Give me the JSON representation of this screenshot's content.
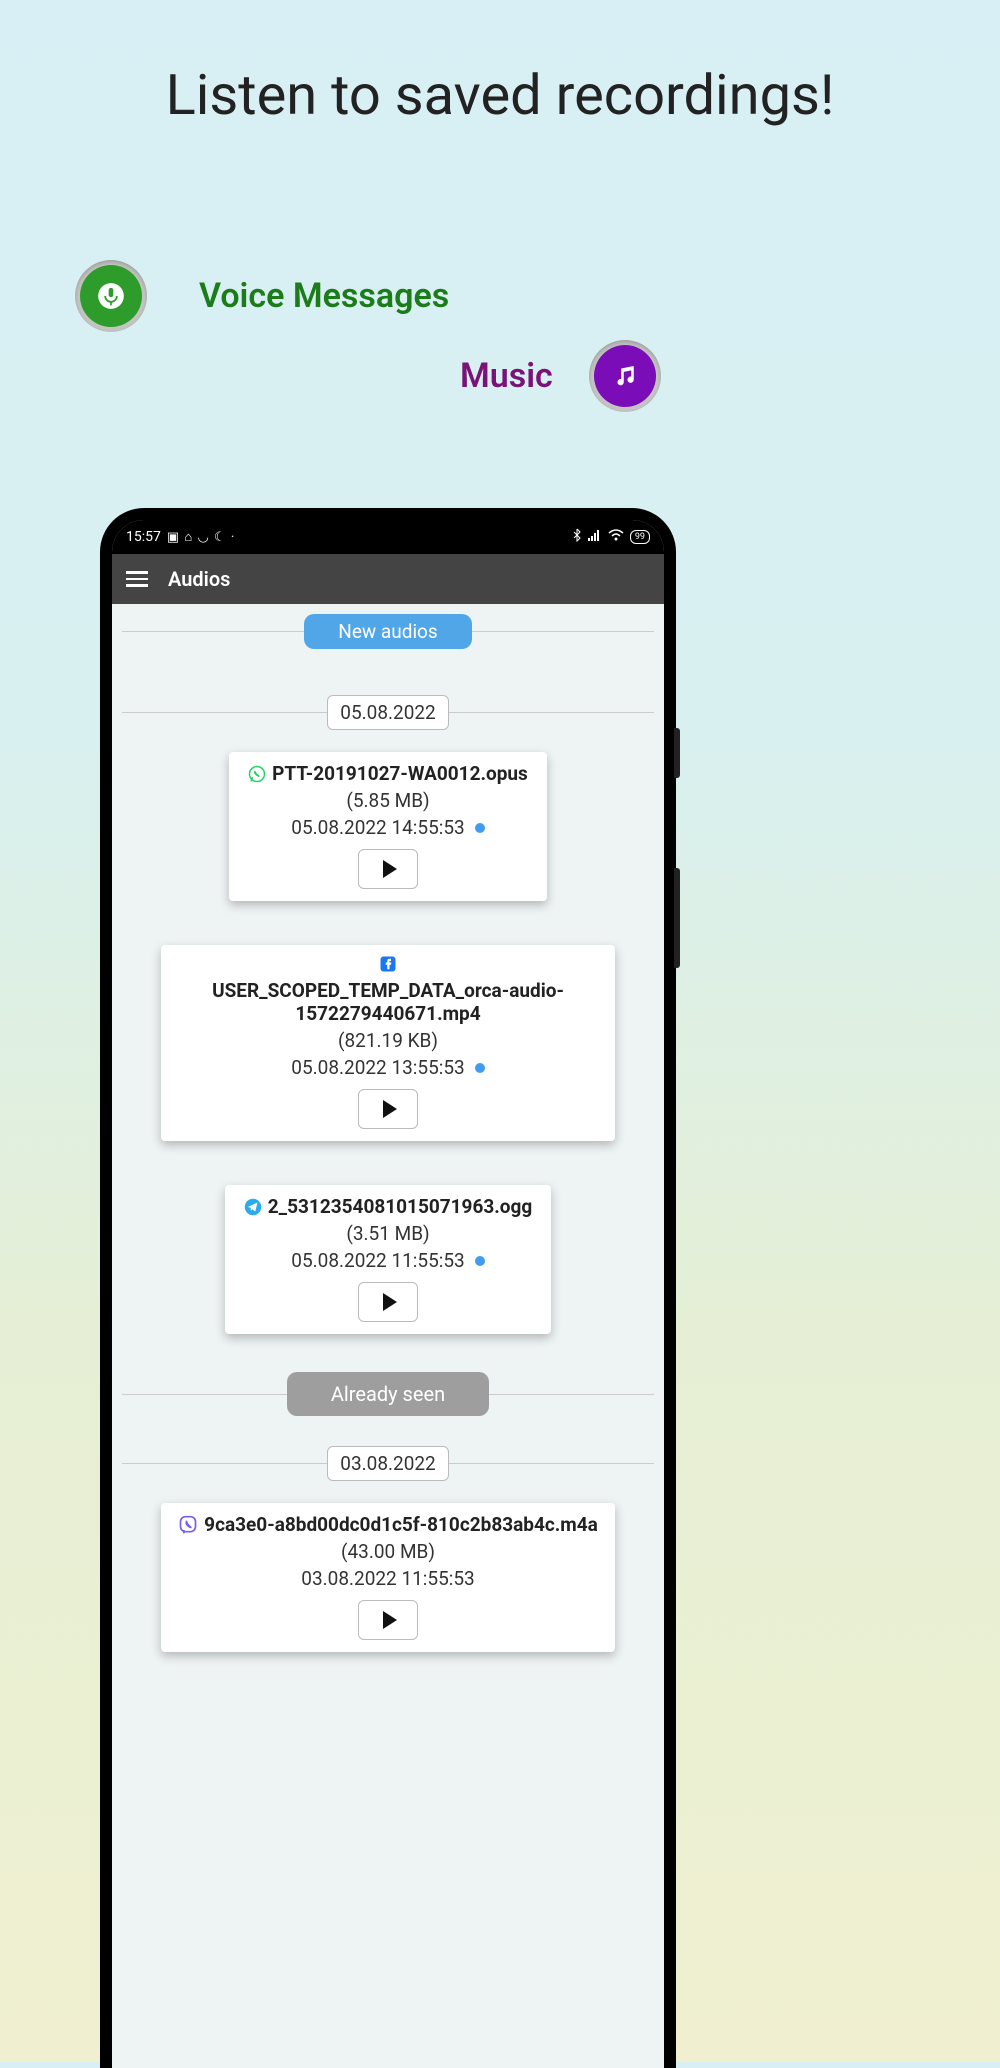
{
  "hero": {
    "title": "Listen to saved recordings!",
    "voice_label": "Voice Messages",
    "music_label": "Music"
  },
  "status_bar": {
    "time": "15:57",
    "battery": "99"
  },
  "app_bar": {
    "title": "Audios"
  },
  "section_labels": {
    "new_audios": "New audios",
    "already_seen": "Already seen"
  },
  "dates": {
    "d1": "05.08.2022",
    "d2": "03.08.2022"
  },
  "cards": [
    {
      "source": "whatsapp",
      "filename": "PTT-20191027-WA0012.opus",
      "size": "(5.85 MB)",
      "timestamp": "05.08.2022 14:55:53",
      "has_dot": true
    },
    {
      "source": "facebook",
      "filename": "USER_SCOPED_TEMP_DATA_orca-audio-1572279440671.mp4",
      "size": "(821.19 KB)",
      "timestamp": "05.08.2022 13:55:53",
      "has_dot": true
    },
    {
      "source": "telegram",
      "filename": "2_5312354081015071963.ogg",
      "size": "(3.51 MB)",
      "timestamp": "05.08.2022 11:55:53",
      "has_dot": true
    },
    {
      "source": "viber",
      "filename": "9ca3e0-a8bd00dc0d1c5f-810c2b83ab4c.m4a",
      "size": "(43.00 MB)",
      "timestamp": "03.08.2022 11:55:53",
      "has_dot": false
    }
  ]
}
